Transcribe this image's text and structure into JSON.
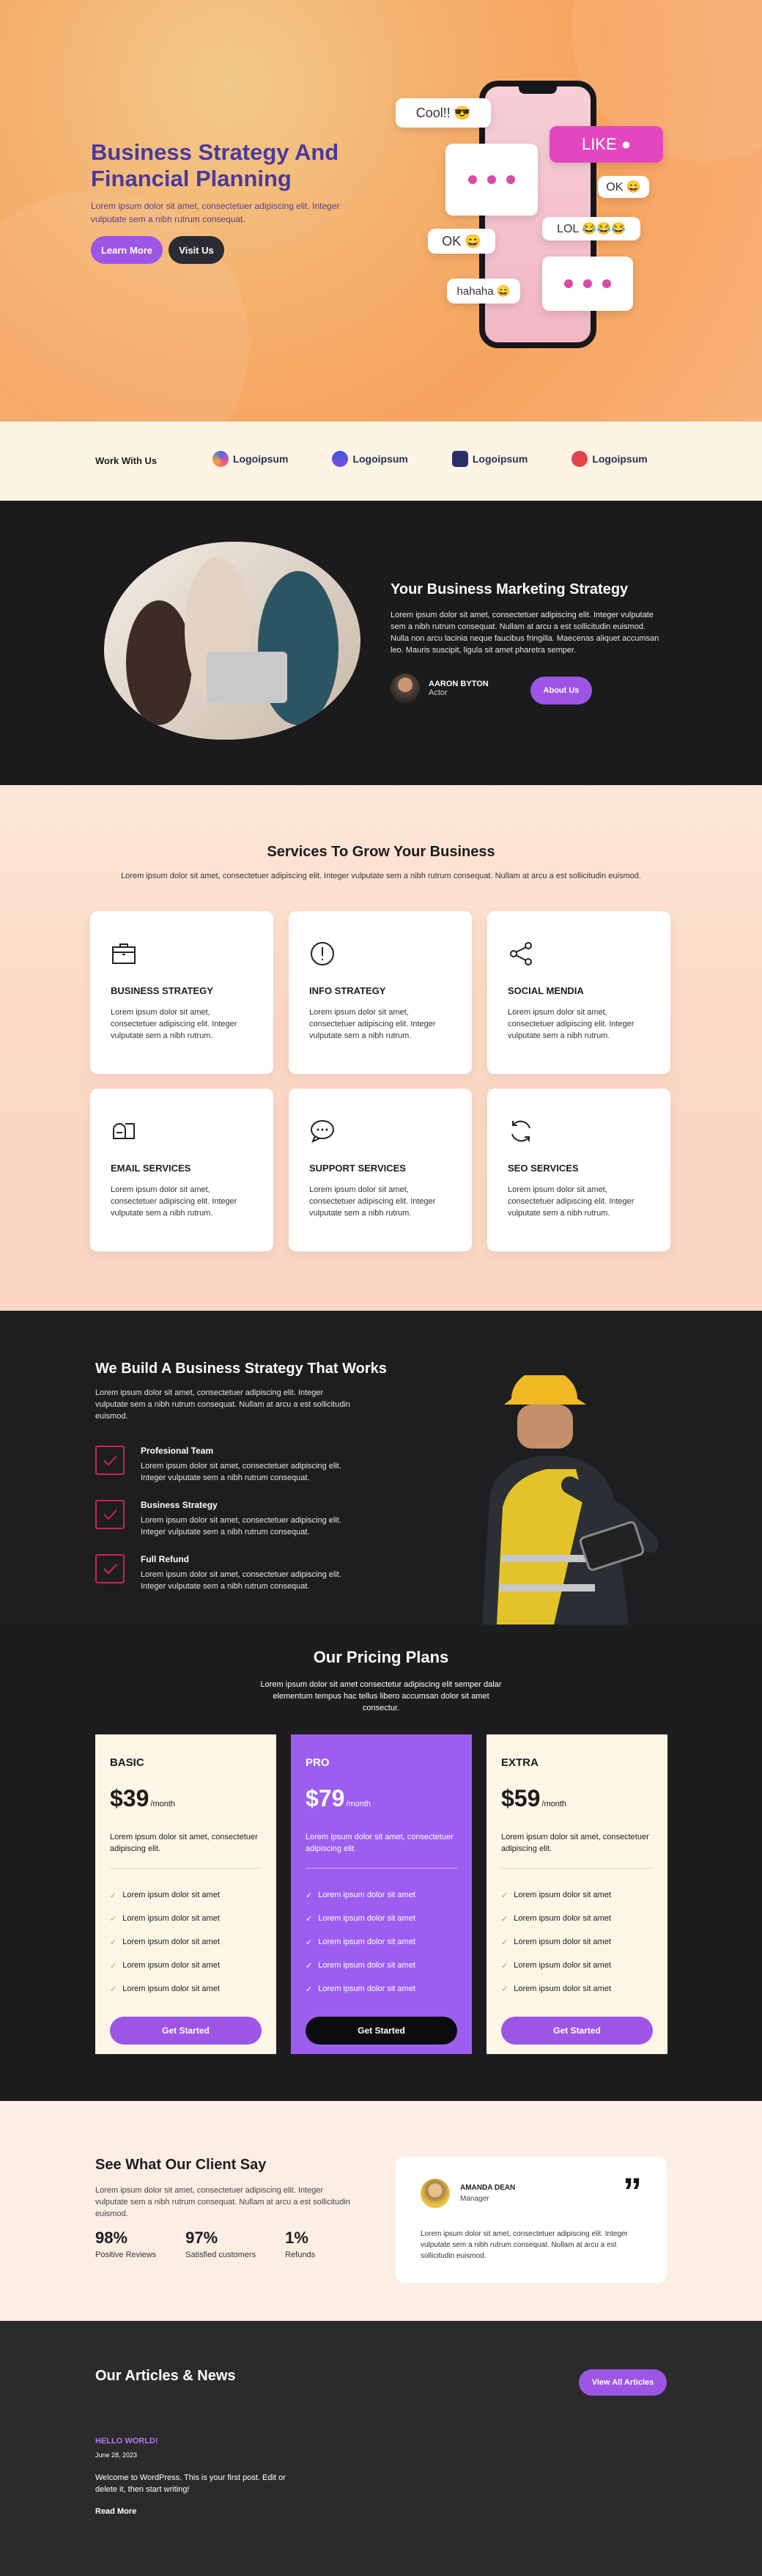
{
  "hero": {
    "title": "Business Strategy And Financial Planning",
    "lead": "Lorem ipsum dolor sit amet, consectetuer adipiscing elit. Integer vulputate sem a nibh rutrum consequat.",
    "btn_primary": "Learn More",
    "btn_secondary": "Visit Us",
    "bubbles": [
      "Cool!! 😎",
      "LIKE ●",
      "OK 😄",
      "LOL 😂😂😂",
      "OK 😄",
      "hahaha 😄"
    ]
  },
  "partners": {
    "label": "Work With Us",
    "logos": [
      "Logoipsum",
      "Logoipsum",
      "Logoipsum",
      "Logoipsum"
    ]
  },
  "about": {
    "title": "Your Business Marketing Strategy",
    "text": "Lorem ipsum dolor sit amet, consectetuer adipiscing elit. Integer vulputate sem a nibh rutrum consequat. Nullam at arcu a est sollicitudin euismod. Nulla non arcu lacinia neque faucibus fringilla. Maecenas aliquet accumsan leo. Mauris suscipit, ligula sit amet pharetra semper.",
    "person_name": "AARON BYTON",
    "person_role": "Actor",
    "button": "About Us"
  },
  "services": {
    "title": "Services To Grow Your Business",
    "subtitle": "Lorem ipsum dolor sit amet, consectetuer adipiscing elit. Integer vulputate sem a nibh rutrum consequat. Nullam at arcu a est sollicitudin euismod.",
    "items": [
      {
        "icon": "briefcase-icon",
        "title": "BUSINESS STRATEGY",
        "text": "Lorem ipsum dolor sit amet, consectetuer adipiscing elit. Integer vulputate sem a nibh rutrum."
      },
      {
        "icon": "info-icon",
        "title": "INFO STRATEGY",
        "text": "Lorem ipsum dolor sit amet, consectetuer adipiscing elit. Integer vulputate sem a nibh rutrum."
      },
      {
        "icon": "share-icon",
        "title": "SOCIAL MENDIA",
        "text": "Lorem ipsum dolor sit amet, consectetuer adipiscing elit. Integer vulputate sem a nibh rutrum."
      },
      {
        "icon": "mailbox-icon",
        "title": "EMAIL SERVICES",
        "text": "Lorem ipsum dolor sit amet, consectetuer adipiscing elit. Integer vulputate sem a nibh rutrum."
      },
      {
        "icon": "chat-icon",
        "title": "SUPPORT SERVICES",
        "text": "Lorem ipsum dolor sit amet, consectetuer adipiscing elit. Integer vulputate sem a nibh rutrum."
      },
      {
        "icon": "refresh-icon",
        "title": "SEO SERVICES",
        "text": "Lorem ipsum dolor sit amet, consectetuer adipiscing elit. Integer vulputate sem a nibh rutrum."
      }
    ]
  },
  "strategy": {
    "title": "We Build A Business Strategy That Works",
    "lead": "Lorem ipsum dolor sit amet, consectetuer adipiscing elit. Integer vulputate sem a nibh rutrum consequat. Nullam at arcu a est sollicitudin euismod.",
    "features": [
      {
        "title": "Profesional Team",
        "text": "Lorem ipsum dolor sit amet, consectetuer adipiscing elit. Integer vulputate sem a nibh rutrum consequat."
      },
      {
        "title": "Business Strategy",
        "text": "Lorem ipsum dolor sit amet, consectetuer adipiscing elit. Integer vulputate sem a nibh rutrum consequat."
      },
      {
        "title": "Full Refund",
        "text": "Lorem ipsum dolor sit amet, consectetuer adipiscing elit. Integer vulputate sem a nibh rutrum consequat."
      }
    ]
  },
  "pricing": {
    "title": "Our Pricing Plans",
    "subtitle": "Lorem ipsum dolor sit amet consectetur adipiscing elit semper dalar elementum tempus hac tellus libero accumsan dolor sit amet consectur.",
    "plans": [
      {
        "name": "BASIC",
        "price": "$39",
        "period": "/month",
        "desc": "Lorem ipsum dolor sit amet, consectetuer adipiscing elit.",
        "features": [
          "Lorem ipsum dolor sit amet",
          "Lorem ipsum dolor sit amet",
          "Lorem ipsum dolor sit amet",
          "Lorem ipsum dolor sit amet",
          "Lorem ipsum dolor sit amet"
        ],
        "button": "Get Started"
      },
      {
        "name": "PRO",
        "price": "$79",
        "period": "/month",
        "desc": "Lorem ipsum dolor sit amet, consectetuer adipiscing elit.",
        "features": [
          "Lorem ipsum dolor sit amet",
          "Lorem ipsum dolor sit amet",
          "Lorem ipsum dolor sit amet",
          "Lorem ipsum dolor sit amet",
          "Lorem ipsum dolor sit amet"
        ],
        "button": "Get Started"
      },
      {
        "name": "EXTRA",
        "price": "$59",
        "period": "/month",
        "desc": "Lorem ipsum dolor sit amet, consectetuer adipiscing elit.",
        "features": [
          "Lorem ipsum dolor sit amet",
          "Lorem ipsum dolor sit amet",
          "Lorem ipsum dolor sit amet",
          "Lorem ipsum dolor sit amet",
          "Lorem ipsum dolor sit amet"
        ],
        "button": "Get Started"
      }
    ]
  },
  "testimonial": {
    "title": "See What Our Client Say",
    "lead": "Lorem ipsum dolor sit amet, consectetuer adipiscing elit. Integer vulputate sem a nibh rutrum consequat. Nullam at arcu a est sollicitudin euismod.",
    "stats": [
      {
        "value": "98%",
        "label": "Positive Reviews"
      },
      {
        "value": "97%",
        "label": "Satisfied customers"
      },
      {
        "value": "1%",
        "label": "Refunds"
      }
    ],
    "client_name": "AMANDA DEAN",
    "client_role": "Manager",
    "quote": "Lorem ipsum dolor sit amet, consectetuer adipiscing elit. Integer vulputate sem a nibh rutrum consequat. Nullam at arcu a est sollicitudin euismod."
  },
  "articles": {
    "title": "Our Articles & News",
    "button": "View All Articles",
    "post": {
      "kicker": "HELLO WORLD!",
      "date": "June 28, 2023",
      "text": "Welcome to WordPress. This is your first post. Edit or delete it, then start writing!",
      "read": "Read More"
    }
  }
}
